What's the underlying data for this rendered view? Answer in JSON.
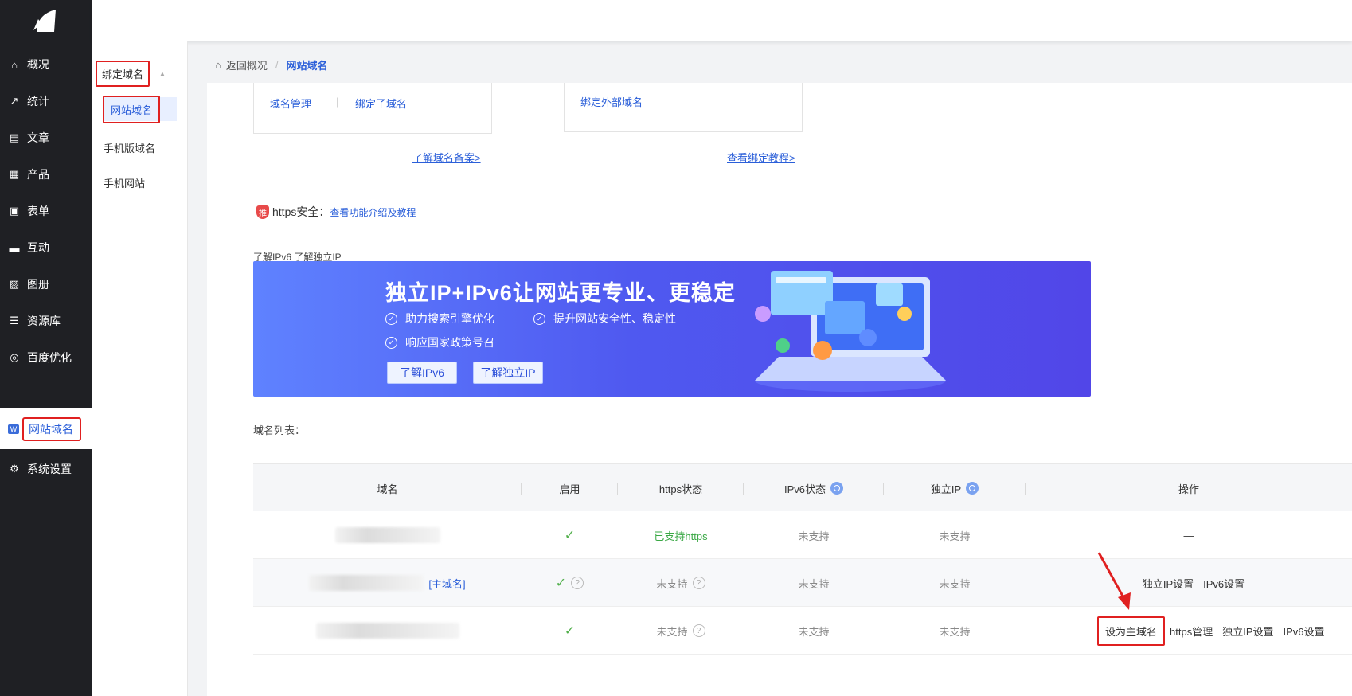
{
  "nav": {
    "items": [
      {
        "label": "概况",
        "icon": "home-icon"
      },
      {
        "label": "统计",
        "icon": "stats-icon"
      },
      {
        "label": "文章",
        "icon": "article-icon"
      },
      {
        "label": "产品",
        "icon": "product-icon"
      },
      {
        "label": "表单",
        "icon": "form-icon"
      },
      {
        "label": "互动",
        "icon": "chat-icon"
      },
      {
        "label": "图册",
        "icon": "gallery-icon"
      },
      {
        "label": "资源库",
        "icon": "database-icon"
      },
      {
        "label": "百度优化",
        "icon": "seo-icon"
      },
      {
        "label": "网站域名",
        "icon": "domain-icon"
      },
      {
        "label": "系统设置",
        "icon": "gear-icon"
      }
    ],
    "active_badge": "W"
  },
  "subnav": {
    "group": "绑定域名",
    "items": [
      "网站域名",
      "手机版域名",
      "手机网站"
    ]
  },
  "breadcrumb": {
    "back": "返回概况",
    "sep": "/",
    "current": "网站域名"
  },
  "cards": {
    "left": {
      "link1": "域名管理",
      "link2": "绑定子域名"
    },
    "right": {
      "link1": "绑定外部域名"
    }
  },
  "links": {
    "beian": "了解域名备案>",
    "tutorial": "查看绑定教程>"
  },
  "https": {
    "badge": "推",
    "label": "https安全：",
    "link": "查看功能介绍及教程"
  },
  "ipv6_caption": "了解IPv6 了解独立IP",
  "banner": {
    "title": "独立IP+IPv6让网站更专业、更稳定",
    "features": [
      "助力搜索引擎优化",
      "提升网站安全性、稳定性",
      "响应国家政策号召"
    ],
    "btn1": "了解IPv6",
    "btn2": "了解独立IP"
  },
  "domain_list_label": "域名列表：",
  "table": {
    "headers": [
      "域名",
      "启用",
      "https状态",
      "IPv6状态",
      "独立IP",
      "操作"
    ],
    "rows": [
      {
        "tag": "",
        "enabled": "✓",
        "https": "已支持https",
        "ipv6": "未支持",
        "ip": "未支持",
        "ops": [
          "—"
        ]
      },
      {
        "tag": "[主域名]",
        "enabled": "✓",
        "https": "未支持",
        "ipv6": "未支持",
        "ip": "未支持",
        "ops": [
          "独立IP设置",
          "IPv6设置"
        ]
      },
      {
        "tag": "",
        "enabled": "✓",
        "https": "未支持",
        "ipv6": "未支持",
        "ip": "未支持",
        "ops": [
          "设为主域名",
          "https管理",
          "独立IP设置",
          "IPv6设置"
        ]
      }
    ]
  },
  "colors": {
    "accent": "#2b5fd9",
    "highlight": "#e02020",
    "nav_bg": "#1f2024",
    "success": "#3aa845"
  }
}
